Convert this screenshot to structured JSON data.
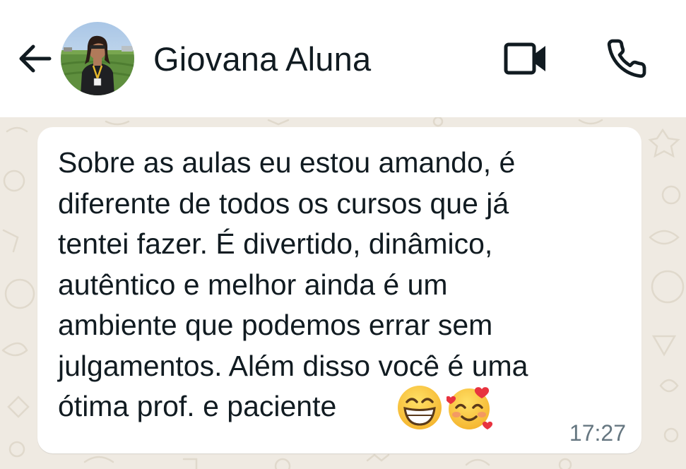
{
  "header": {
    "back_icon": "arrow-left-icon",
    "contact_name": "Giovana Aluna",
    "video_icon": "video-camera-icon",
    "call_icon": "phone-icon"
  },
  "message": {
    "text": "Sobre as aulas eu estou amando, é\ndiferente de todos os cursos que já\ntentei fazer. É divertido, dinâmico,\nautêntico e melhor ainda é um\nambiente que podemos errar sem\njulgamentos. Além disso você é uma\nótima prof. e paciente",
    "emojis": [
      "grinning-face-emoji",
      "smiling-face-with-hearts-emoji"
    ],
    "time": "17:27"
  },
  "colors": {
    "header_bg": "#ffffff",
    "chat_bg": "#efeae2",
    "bubble_bg": "#ffffff",
    "text": "#111b21",
    "timestamp": "#667781"
  }
}
